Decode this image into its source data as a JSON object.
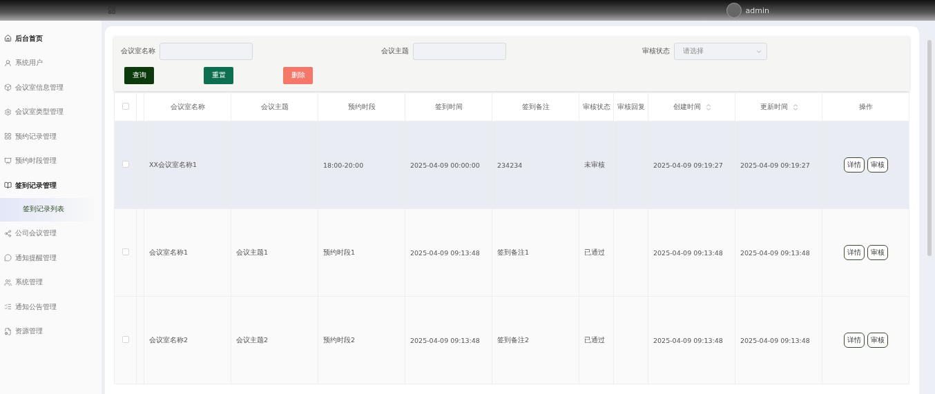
{
  "header": {
    "user": "admin"
  },
  "sidebar": {
    "items": [
      {
        "label": "后台首页",
        "kind": "home",
        "selected": false,
        "emphasized": true
      },
      {
        "label": "系统用户",
        "kind": "user",
        "selected": false
      },
      {
        "label": "会议室信息管理",
        "kind": "box",
        "selected": false
      },
      {
        "label": "会议室类型管理",
        "kind": "gear",
        "selected": false
      },
      {
        "label": "预约记录管理",
        "kind": "grid",
        "selected": false
      },
      {
        "label": "预约时段管理",
        "kind": "board",
        "selected": false
      },
      {
        "label": "签到记录管理",
        "kind": "book",
        "selected": false,
        "expanded": true,
        "children": [
          {
            "label": "签到记录列表",
            "selected": true
          }
        ]
      },
      {
        "label": "公司会议管理",
        "kind": "share",
        "selected": false
      },
      {
        "label": "通知提醒管理",
        "kind": "chat",
        "selected": false
      },
      {
        "label": "系统管理",
        "kind": "users",
        "selected": false
      },
      {
        "label": "通知公告管理",
        "kind": "list",
        "selected": false
      },
      {
        "label": "资源管理",
        "kind": "file",
        "selected": false
      }
    ]
  },
  "filters": [
    {
      "label": "会议室名称",
      "kind": "text"
    },
    {
      "label": "会议主题",
      "kind": "text"
    },
    {
      "label": "审核状态",
      "kind": "select",
      "placeholder": "请选择"
    }
  ],
  "buttons": [
    {
      "label": "查询",
      "kind": "query"
    },
    {
      "label": "重置",
      "kind": "reset"
    },
    {
      "label": "删除",
      "kind": "delete"
    }
  ],
  "table": {
    "all_checked": false,
    "columns": [
      {
        "label": "会议室名称"
      },
      {
        "label": "会议主题"
      },
      {
        "label": "预约时段"
      },
      {
        "label": "签到时间"
      },
      {
        "label": "签到备注"
      },
      {
        "label": "审核状态"
      },
      {
        "label": "审核回复"
      },
      {
        "label": "创建时间",
        "sortable": true
      },
      {
        "label": "更新时间",
        "sortable": true
      },
      {
        "label": "操作"
      }
    ],
    "rows": [
      {
        "checked": false,
        "highlighted": true,
        "cells": [
          "XX会议室名称1",
          "",
          "18:00-20:00",
          "2025-04-09 00:00:00",
          "234234",
          "未审核",
          "",
          "2025-04-09 09:19:27",
          "2025-04-09 09:19:27"
        ],
        "actions": [
          "详情",
          "审核"
        ]
      },
      {
        "checked": false,
        "highlighted": false,
        "cells": [
          "会议室名称1",
          "会议主题1",
          "预约时段1",
          "2025-04-09 09:13:48",
          "签到备注1",
          "已通过",
          "",
          "2025-04-09 09:13:48",
          "2025-04-09 09:13:48"
        ],
        "actions": [
          "详情",
          "审核"
        ]
      },
      {
        "checked": false,
        "highlighted": false,
        "cells": [
          "会议室名称2",
          "会议主题2",
          "预约时段2",
          "2025-04-09 09:13:48",
          "签到备注2",
          "已通过",
          "",
          "2025-04-09 09:13:48",
          "2025-04-09 09:13:48"
        ],
        "actions": [
          "详情",
          "审核"
        ]
      }
    ]
  }
}
